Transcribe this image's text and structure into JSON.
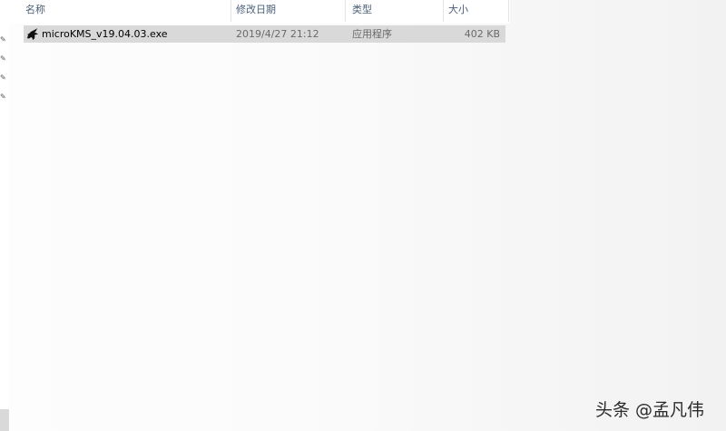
{
  "columns": {
    "name": "名称",
    "date": "修改日期",
    "type": "类型",
    "size": "大小"
  },
  "files": [
    {
      "name": "microKMS_v19.04.03.exe",
      "date": "2019/4/27 21:12",
      "type": "应用程序",
      "size": "402 KB",
      "icon": "dragon-app-icon",
      "selected": true
    }
  ],
  "sidebar": {
    "pins": [
      "pin-icon",
      "pin-icon",
      "pin-icon",
      "pin-icon"
    ]
  },
  "watermark": "头条 @孟凡伟"
}
